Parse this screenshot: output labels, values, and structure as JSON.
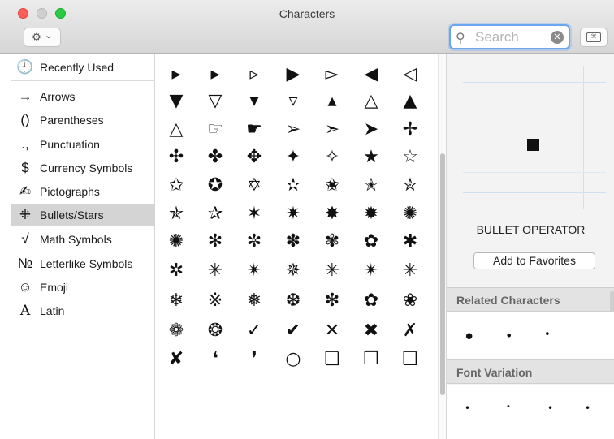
{
  "window": {
    "title": "Characters"
  },
  "toolbar": {
    "gear_icon": "⚙",
    "gear_chevron": "⌄",
    "search_placeholder": "Search",
    "search_icon": "⚲",
    "clear_icon": "✕",
    "keyboard_glyph": "⌘"
  },
  "sidebar": {
    "items": [
      {
        "label": "Recently Used",
        "icon": "🕘"
      },
      {
        "label": "Arrows",
        "icon": "→"
      },
      {
        "label": "Parentheses",
        "icon": "()"
      },
      {
        "label": "Punctuation",
        "icon": ".,"
      },
      {
        "label": "Currency Symbols",
        "icon": "$"
      },
      {
        "label": "Pictographs",
        "icon": "✍"
      },
      {
        "label": "Bullets/Stars",
        "icon": "⁜",
        "selected": true
      },
      {
        "label": "Math Symbols",
        "icon": "√"
      },
      {
        "label": "Letterlike Symbols",
        "icon": "№"
      },
      {
        "label": "Emoji",
        "icon": "☺"
      },
      {
        "label": "Latin",
        "icon": "A"
      }
    ]
  },
  "grid": {
    "rows": [
      [
        "▸",
        "▸",
        "▹",
        "▶",
        "▻",
        "◀",
        "◁"
      ],
      [
        "▼",
        "▽",
        "▾",
        "▿",
        "▴",
        "△",
        "▲"
      ],
      [
        "△",
        "☞",
        "☛",
        "➢",
        "➣",
        "➤",
        "✢"
      ],
      [
        "✣",
        "✤",
        "✥",
        "✦",
        "✧",
        "★",
        "☆"
      ],
      [
        "✩",
        "✪",
        "✡",
        "✫",
        "✬",
        "✭",
        "✮"
      ],
      [
        "✯",
        "✰",
        "✶",
        "✷",
        "✸",
        "✹",
        "✺"
      ],
      [
        "✺",
        "✻",
        "✼",
        "✽",
        "✾",
        "✿",
        "✱"
      ],
      [
        "✲",
        "✳",
        "✴",
        "✵",
        "✳",
        "✴",
        "✳"
      ],
      [
        "❄",
        "※",
        "❅",
        "❆",
        "❇",
        "✿",
        "❀"
      ],
      [
        "❁",
        "❂",
        "✓",
        "✔",
        "✕",
        "✖",
        "✗"
      ],
      [
        "✘",
        "❛",
        "❜",
        "○",
        "❏",
        "❐",
        "❑"
      ]
    ]
  },
  "detail": {
    "preview_glyph": "■",
    "character_name": "BULLET OPERATOR",
    "add_to_favorites_label": "Add to Favorites",
    "related_header": "Related Characters",
    "related_glyphs": [
      "•",
      "•",
      "•"
    ],
    "font_variation_header": "Font Variation",
    "font_variation_glyphs": [
      "•",
      "•",
      "•",
      "•"
    ]
  }
}
